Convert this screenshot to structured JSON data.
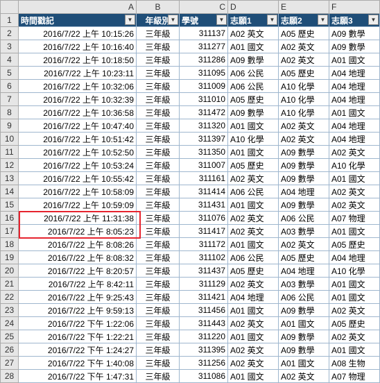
{
  "colLetters": [
    "A",
    "B",
    "C",
    "D",
    "E",
    "F"
  ],
  "headers": [
    "時間戳記",
    "年級別",
    "學號",
    "志願1",
    "志願2",
    "志願3"
  ],
  "rows": [
    [
      "2016/7/22 上午 10:15:26",
      "三年級",
      "311137",
      "A02 英文",
      "A05 歷史",
      "A09 數學"
    ],
    [
      "2016/7/22 上午 10:16:40",
      "三年級",
      "311277",
      "A01 國文",
      "A02 英文",
      "A09 數學"
    ],
    [
      "2016/7/22 上午 10:18:50",
      "三年級",
      "311286",
      "A09 數學",
      "A02 英文",
      "A01 國文"
    ],
    [
      "2016/7/22 上午 10:23:11",
      "三年級",
      "311095",
      "A06 公民",
      "A05 歷史",
      "A04 地理"
    ],
    [
      "2016/7/22 上午 10:32:06",
      "三年級",
      "311009",
      "A06 公民",
      "A10 化學",
      "A04 地理"
    ],
    [
      "2016/7/22 上午 10:32:39",
      "三年級",
      "311010",
      "A05 歷史",
      "A10 化學",
      "A04 地理"
    ],
    [
      "2016/7/22 上午 10:36:58",
      "三年級",
      "311472",
      "A09 數學",
      "A10 化學",
      "A01 國文"
    ],
    [
      "2016/7/22 上午 10:47:40",
      "三年級",
      "311320",
      "A01 國文",
      "A02 英文",
      "A04 地理"
    ],
    [
      "2016/7/22 上午 10:51:42",
      "三年級",
      "311397",
      "A10 化學",
      "A02 英文",
      "A04 地理"
    ],
    [
      "2016/7/22 上午 10:52:50",
      "三年級",
      "311350",
      "A01 國文",
      "A09 數學",
      "A02 英文"
    ],
    [
      "2016/7/22 上午 10:53:24",
      "三年級",
      "311007",
      "A05 歷史",
      "A09 數學",
      "A10 化學"
    ],
    [
      "2016/7/22 上午 10:55:42",
      "三年級",
      "311161",
      "A02 英文",
      "A09 數學",
      "A01 國文"
    ],
    [
      "2016/7/22 上午 10:58:09",
      "三年級",
      "311414",
      "A06 公民",
      "A04 地理",
      "A02 英文"
    ],
    [
      "2016/7/22 上午 10:59:09",
      "三年級",
      "311431",
      "A01 國文",
      "A09 數學",
      "A02 英文"
    ],
    [
      "2016/7/22 上午 11:31:38",
      "三年級",
      "311076",
      "A02 英文",
      "A06 公民",
      "A07 物理"
    ],
    [
      "2016/7/22 上午 8:05:23",
      "三年級",
      "311417",
      "A02 英文",
      "A03 數學",
      "A01 國文"
    ],
    [
      "2016/7/22 上午 8:08:26",
      "三年級",
      "311172",
      "A01 國文",
      "A02 英文",
      "A05 歷史"
    ],
    [
      "2016/7/22 上午 8:08:32",
      "三年級",
      "311102",
      "A06 公民",
      "A05 歷史",
      "A04 地理"
    ],
    [
      "2016/7/22 上午 8:20:57",
      "三年級",
      "311437",
      "A05 歷史",
      "A04 地理",
      "A10 化學"
    ],
    [
      "2016/7/22 上午 8:42:11",
      "三年級",
      "311129",
      "A02 英文",
      "A03 數學",
      "A01 國文"
    ],
    [
      "2016/7/22 上午 9:25:43",
      "三年級",
      "311421",
      "A04 地理",
      "A06 公民",
      "A01 國文"
    ],
    [
      "2016/7/22 上午 9:59:13",
      "三年級",
      "311456",
      "A01 國文",
      "A09 數學",
      "A02 英文"
    ],
    [
      "2016/7/22 下午 1:22:06",
      "三年級",
      "311443",
      "A02 英文",
      "A01 國文",
      "A05 歷史"
    ],
    [
      "2016/7/22 下午 1:22:21",
      "三年級",
      "311220",
      "A01 國文",
      "A09 數學",
      "A02 英文"
    ],
    [
      "2016/7/22 下午 1:24:27",
      "三年級",
      "311395",
      "A02 英文",
      "A09 數學",
      "A01 國文"
    ],
    [
      "2016/7/22 下午 1:40:08",
      "三年級",
      "311256",
      "A02 英文",
      "A01 國文",
      "A08 生物"
    ],
    [
      "2016/7/22 下午 1:47:31",
      "三年級",
      "311086",
      "A01 國文",
      "A02 英文",
      "A07 物理"
    ]
  ],
  "filterGlyph": "▼"
}
